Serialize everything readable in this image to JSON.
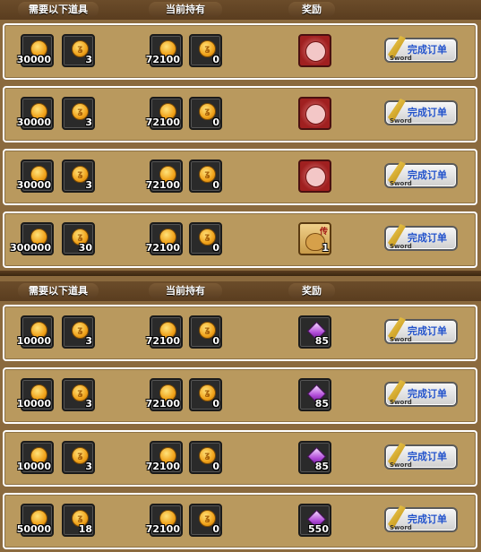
{
  "headers": {
    "required": "需要以下道具",
    "current": "当前持有",
    "reward": "奖励"
  },
  "button": {
    "label": "完成订单",
    "sub": "Sword"
  },
  "rows": [
    {
      "req_a": "30000",
      "req_b": "3",
      "have_a": "72100",
      "have_b": "0",
      "reward_type": "red-token",
      "reward_qty": ""
    },
    {
      "req_a": "30000",
      "req_b": "3",
      "have_a": "72100",
      "have_b": "0",
      "reward_type": "red-token",
      "reward_qty": ""
    },
    {
      "req_a": "30000",
      "req_b": "3",
      "have_a": "72100",
      "have_b": "0",
      "reward_type": "red-token",
      "reward_qty": ""
    },
    {
      "req_a": "300000",
      "req_b": "30",
      "have_a": "72100",
      "have_b": "0",
      "reward_type": "legend-bag",
      "reward_qty": "1",
      "reward_tag": "传"
    },
    {
      "req_a": "10000",
      "req_b": "3",
      "have_a": "72100",
      "have_b": "0",
      "reward_type": "purple-gem",
      "reward_qty": "85"
    },
    {
      "req_a": "10000",
      "req_b": "3",
      "have_a": "72100",
      "have_b": "0",
      "reward_type": "purple-gem",
      "reward_qty": "85"
    },
    {
      "req_a": "10000",
      "req_b": "3",
      "have_a": "72100",
      "have_b": "0",
      "reward_type": "purple-gem",
      "reward_qty": "85"
    },
    {
      "req_a": "50000",
      "req_b": "18",
      "have_a": "72100",
      "have_b": "0",
      "reward_type": "purple-gem",
      "reward_qty": "550"
    }
  ]
}
